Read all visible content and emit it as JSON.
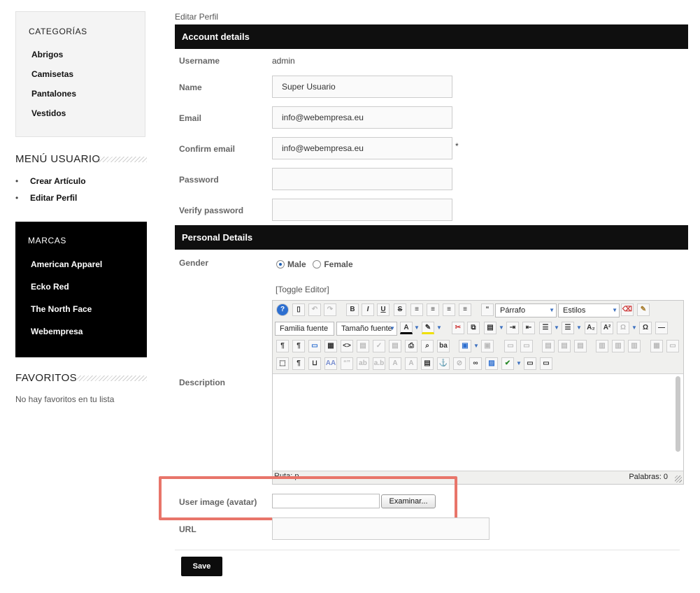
{
  "sidebar": {
    "categories": {
      "title": "CATEGORÍAS",
      "items": [
        "Abrigos",
        "Camisetas",
        "Pantalones",
        "Vestidos"
      ]
    },
    "user_menu": {
      "title": "MENÚ USUARIO",
      "items": [
        "Crear Artículo",
        "Editar Perfil"
      ]
    },
    "brands": {
      "title": "MARCAS",
      "items": [
        "American Apparel",
        "Ecko Red",
        "The North Face",
        "Webempresa"
      ]
    },
    "favorites": {
      "title": "FAVORITOS",
      "empty_text": "No hay favoritos en tu lista"
    }
  },
  "main": {
    "breadcrumb": "Editar Perfil",
    "account_section": "Account details",
    "fields": {
      "username_label": "Username",
      "username_value": "admin",
      "name_label": "Name",
      "name_value": "Super Usuario",
      "email_label": "Email",
      "email_value": "info@webempresa.eu",
      "confirm_email_label": "Confirm email",
      "confirm_email_value": "info@webempresa.eu",
      "required_mark": "*",
      "password_label": "Password",
      "verify_password_label": "Verify password"
    },
    "personal_section": "Personal Details",
    "gender": {
      "label": "Gender",
      "options": [
        "Male",
        "Female"
      ],
      "selected": "Male"
    },
    "toggle_editor": "[Toggle Editor]",
    "description_label": "Description",
    "editor": {
      "format_select": "Párrafo",
      "styles_select": "Estilos",
      "font_family_select": "Familia fuente",
      "font_size_select": "Tamaño fuente",
      "path_text": "Ruta: p",
      "word_count": "Palabras: 0"
    },
    "avatar": {
      "label": "User image (avatar)",
      "browse_button": "Examinar..."
    },
    "url_label": "URL",
    "save_button": "Save"
  },
  "colors": {
    "section_bar": "#0f0f0f",
    "highlight_border": "#e8756a",
    "radio_accent": "#1e5fb3"
  }
}
